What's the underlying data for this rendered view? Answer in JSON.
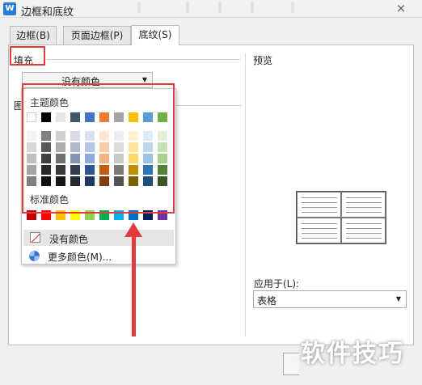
{
  "window": {
    "title": "边框和底纹",
    "app_icon": "W",
    "close_glyph": "×"
  },
  "tabs": [
    {
      "label": "边框(B)",
      "active": false
    },
    {
      "label": "页面边框(P)",
      "active": false
    },
    {
      "label": "底纹(S)",
      "active": true
    }
  ],
  "fill": {
    "label": "填充",
    "color_select": {
      "value": "没有颜色",
      "arrow": "▼"
    }
  },
  "pattern": {
    "label": "图"
  },
  "preview": {
    "label": "预览"
  },
  "apply_to": {
    "label": "应用于(L):",
    "value": "表格",
    "arrow": "▼"
  },
  "palette": {
    "theme_title": "主题颜色",
    "theme_top": [
      "#ffffff",
      "#000000",
      "#e7e6e6",
      "#44546a",
      "#4472c4",
      "#ed7d31",
      "#a5a5a5",
      "#ffc000",
      "#5b9bd5",
      "#70ad47"
    ],
    "theme_shades": [
      [
        "#f2f2f2",
        "#7f7f7f",
        "#d0cece",
        "#d6dce4",
        "#d9e2f3",
        "#fbe5d5",
        "#ededed",
        "#fff2cc",
        "#deebf6",
        "#e2efd9"
      ],
      [
        "#d8d8d8",
        "#595959",
        "#aeaaaa",
        "#adb9ca",
        "#b4c6e7",
        "#f7cbac",
        "#dbdbdb",
        "#fee599",
        "#bdd7ee",
        "#c5e0b3"
      ],
      [
        "#bfbfbf",
        "#3f3f3f",
        "#757070",
        "#8496b0",
        "#8eaadb",
        "#f4b183",
        "#c9c9c9",
        "#ffd965",
        "#9cc3e5",
        "#a8d08d"
      ],
      [
        "#a5a5a5",
        "#262626",
        "#3a3838",
        "#323f4f",
        "#2f5496",
        "#c55a11",
        "#7b7b7b",
        "#bf9000",
        "#2e75b5",
        "#538135"
      ],
      [
        "#7f7f7f",
        "#0c0c0c",
        "#171616",
        "#222a35",
        "#1f3864",
        "#833c0b",
        "#525252",
        "#7f6000",
        "#1e4e79",
        "#375623"
      ]
    ],
    "standard_title": "标准颜色",
    "standard": [
      "#c00000",
      "#ff0000",
      "#ffc000",
      "#ffff00",
      "#92d050",
      "#00b050",
      "#00b0f0",
      "#0070c0",
      "#002060",
      "#7030a0"
    ],
    "no_color_label": "没有颜色",
    "more_colors_label": "更多颜色(M)..."
  },
  "watermark": "软件技巧",
  "annotation_color": "#e23b3b"
}
